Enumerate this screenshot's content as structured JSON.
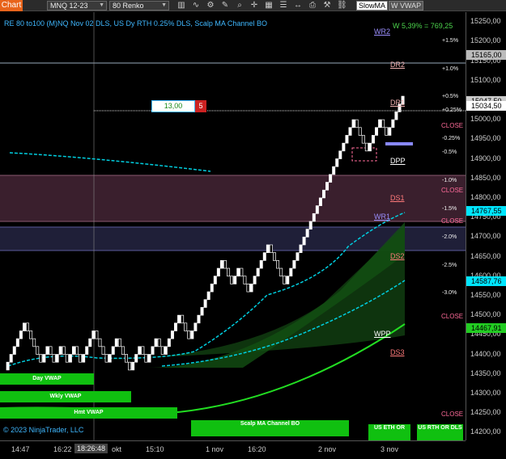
{
  "toolbar": {
    "chart_tab": "Chart",
    "instrument": "MNQ 12-23",
    "bar_type": "80 Renko",
    "indicator1": "SlowMA",
    "indicator2": "W VWAP"
  },
  "chart": {
    "title": "RE 80 to100 (M)NQ Nov 02 DLS, US Dy RTH 0.25% DLS, Scalp MA Channel BO",
    "copyright": "© 2023 NinjaTrader, LLC",
    "stat": "W 5,39% = 769,25",
    "order_price": "13,00",
    "order_qty": "5",
    "levels": [
      {
        "name": "WR2",
        "color": "#9b8fff"
      },
      {
        "name": "DR2",
        "color": "#f0b0b0"
      },
      {
        "name": "DR1",
        "color": "#f0b0b0"
      },
      {
        "name": "DPP",
        "color": "#ffffff"
      },
      {
        "name": "DS1",
        "color": "#ff7a7a"
      },
      {
        "name": "WR1",
        "color": "#9b8fff"
      },
      {
        "name": "DS2",
        "color": "#ff7a7a"
      },
      {
        "name": "WPP",
        "color": "#ffffff"
      },
      {
        "name": "DS3",
        "color": "#ff7a7a"
      }
    ],
    "pct_labels": [
      "+1.5%",
      "+1.0%",
      "+0.5%",
      "+0.25%",
      "-0.25%",
      "-0.5%",
      "-1.0%",
      "-1.5%",
      "-2.0%",
      "-2.5%",
      "-3.0%"
    ],
    "close_label": "CLOSE",
    "vwap_boxes": [
      "Day VWAP",
      "Wkly VWAP",
      "Hmt VWAP"
    ],
    "bottom_boxes": [
      "Scalp MA Channel BO",
      "US ETH OR",
      "US RTH OR DLS"
    ]
  },
  "price_axis": {
    "labels": [
      "15250,00",
      "15200,00",
      "15150,00",
      "15100,00",
      "15050,00",
      "15000,00",
      "14950,00",
      "14900,00",
      "14850,00",
      "14800,00",
      "14750,00",
      "14700,00",
      "14650,00",
      "14600,00",
      "14550,00",
      "14500,00",
      "14450,00",
      "14400,00",
      "14350,00",
      "14300,00",
      "14250,00",
      "14200,00"
    ],
    "flags": [
      {
        "text": "15165,00",
        "bg": "#bbbbbb",
        "fg": "#000000"
      },
      {
        "text": "15047,50",
        "bg": "#cccccc",
        "fg": "#000000"
      },
      {
        "text": "15034,50",
        "bg": "#ffffff",
        "fg": "#000000"
      },
      {
        "text": "14767,55",
        "bg": "#00e5ff",
        "fg": "#000000"
      },
      {
        "text": "14587,76",
        "bg": "#00e5ff",
        "fg": "#000000"
      },
      {
        "text": "14467,91",
        "bg": "#22cc22",
        "fg": "#000000"
      }
    ]
  },
  "time_axis": {
    "labels": [
      "14:47",
      "16:22",
      "okt",
      "15:10",
      "1 nov",
      "16:20",
      "2 nov",
      "3 nov"
    ],
    "cursor_time": "18:26:48"
  },
  "colors": {
    "accent": "#e8641b",
    "title": "#3fb8ff",
    "vwap_green": "#10c010",
    "cyan": "#00e5ff",
    "close_pink": "#ff6b9a"
  },
  "chart_data": {
    "type": "renko",
    "ylim": [
      14180,
      15275
    ],
    "brick_size": 20,
    "closes": [
      14380,
      14400,
      14420,
      14440,
      14460,
      14480,
      14460,
      14440,
      14420,
      14400,
      14380,
      14400,
      14420,
      14400,
      14380,
      14400,
      14420,
      14400,
      14380,
      14400,
      14420,
      14400,
      14380,
      14400,
      14420,
      14440,
      14460,
      14440,
      14420,
      14400,
      14380,
      14400,
      14420,
      14440,
      14420,
      14400,
      14380,
      14360,
      14380,
      14400,
      14420,
      14400,
      14380,
      14400,
      14420,
      14440,
      14420,
      14400,
      14420,
      14440,
      14460,
      14480,
      14500,
      14480,
      14460,
      14440,
      14460,
      14480,
      14500,
      14520,
      14540,
      14560,
      14580,
      14600,
      14620,
      14640,
      14620,
      14600,
      14580,
      14600,
      14620,
      14600,
      14580,
      14560,
      14580,
      14600,
      14620,
      14640,
      14660,
      14680,
      14660,
      14640,
      14620,
      14600,
      14580,
      14600,
      14620,
      14640,
      14660,
      14680,
      14700,
      14720,
      14740,
      14760,
      14780,
      14800,
      14820,
      14840,
      14860,
      14880,
      14900,
      14920,
      14940,
      14960,
      14980,
      15000,
      14980,
      14960,
      14940,
      14920,
      14940,
      14960,
      14980,
      15000,
      14980,
      14960,
      14980,
      15000,
      15020,
      15040,
      15060
    ]
  }
}
